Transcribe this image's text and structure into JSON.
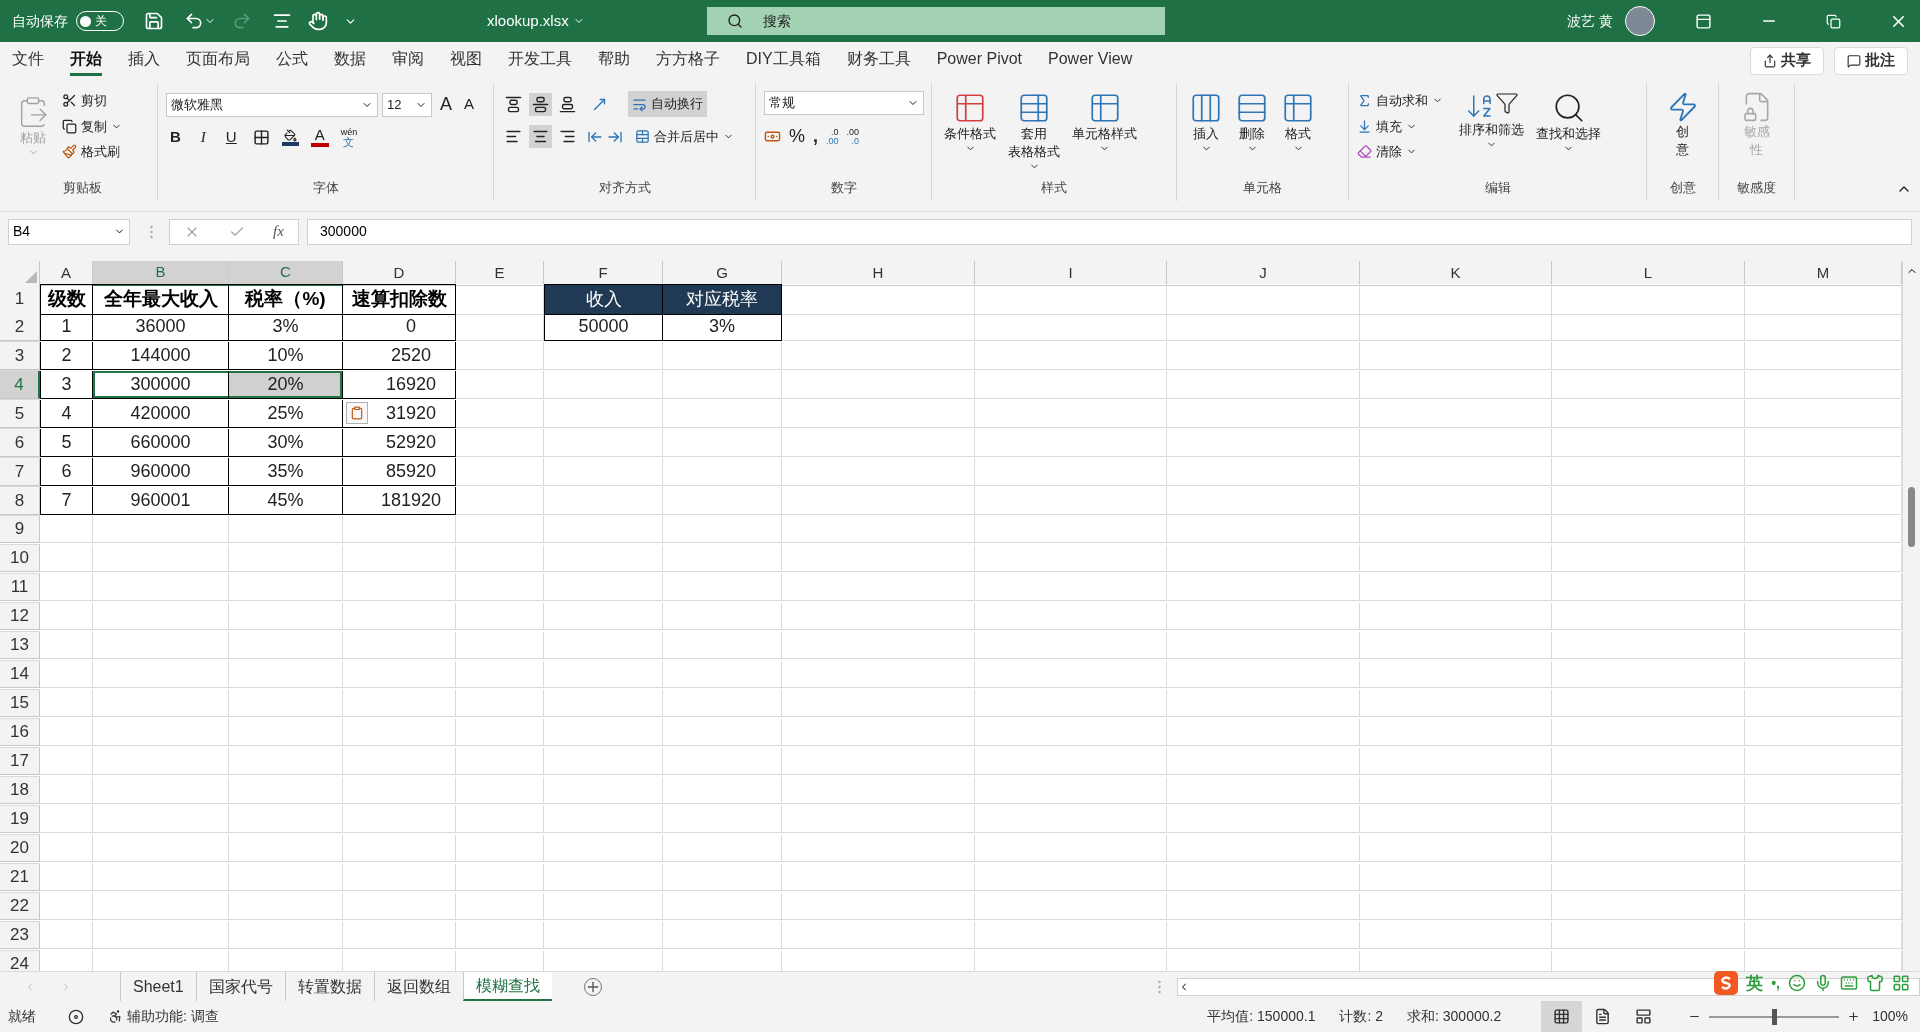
{
  "title_bar": {
    "autosave_label": "自动保存",
    "autosave_toggle": {
      "label": "关",
      "on": false
    },
    "filename": "xlookup.xlsx",
    "search_placeholder": "搜索",
    "user": "波艺 黄"
  },
  "menu_tabs": [
    {
      "label": "文件",
      "selected": false
    },
    {
      "label": "开始",
      "selected": true
    },
    {
      "label": "插入",
      "selected": false
    },
    {
      "label": "页面布局",
      "selected": false
    },
    {
      "label": "公式",
      "selected": false
    },
    {
      "label": "数据",
      "selected": false
    },
    {
      "label": "审阅",
      "selected": false
    },
    {
      "label": "视图",
      "selected": false
    },
    {
      "label": "开发工具",
      "selected": false
    },
    {
      "label": "帮助",
      "selected": false
    },
    {
      "label": "方方格子",
      "selected": false
    },
    {
      "label": "DIY工具箱",
      "selected": false
    },
    {
      "label": "财务工具",
      "selected": false
    },
    {
      "label": "Power Pivot",
      "selected": false
    },
    {
      "label": "Power View",
      "selected": false
    }
  ],
  "share_button": "共享",
  "comments_button": "批注",
  "ribbon": {
    "clipboard": {
      "label": "剪贴板",
      "paste": [
        "粘",
        "贴"
      ],
      "cut": "剪切",
      "copy": "复制",
      "format_painter": "格式刷"
    },
    "font": {
      "label": "字体",
      "font_name": "微软雅黑",
      "font_size": "12",
      "grow": "A",
      "shrink": "A",
      "bold": "B",
      "italic": "I",
      "underline": "U",
      "font_color": "A",
      "phonetic_top": "wén",
      "phonetic_bottom": "文"
    },
    "alignment": {
      "label": "对齐方式",
      "vertical": [
        {
          "selected": false
        },
        {
          "selected": true
        },
        {
          "selected": false
        }
      ],
      "horizontal": [
        {
          "selected": false
        },
        {
          "selected": true
        },
        {
          "selected": false
        }
      ],
      "wrap_text": {
        "label": "自动换行",
        "on": true
      },
      "merge": "合并后居中"
    },
    "number": {
      "label": "数字",
      "format": "常规",
      "percent": "%",
      "comma": ",",
      "increase_decimal": [
        ".0",
        ".00"
      ],
      "decrease_decimal": [
        ".00",
        ".0"
      ]
    },
    "styles": {
      "label": "样式",
      "buttons": [
        [
          "条件格式"
        ],
        [
          "套用",
          "表格格式"
        ],
        [
          "单元格样式"
        ]
      ]
    },
    "cells": {
      "label": "单元格",
      "buttons": [
        "插入",
        "删除",
        "格式"
      ]
    },
    "editing": {
      "label": "编辑",
      "small": [
        "自动求和",
        "填充",
        "清除"
      ],
      "large": [
        "排序和筛选",
        "查找和选择"
      ]
    },
    "ideas": {
      "label": "创意",
      "button": [
        "创",
        "意"
      ]
    },
    "sensitivity": {
      "label": "敏感度",
      "button": [
        "敏感",
        "性"
      ],
      "disabled": true
    }
  },
  "formula_bar": {
    "name_box": "B4",
    "fx": "fx",
    "value": "300000"
  },
  "columns": [
    {
      "label": "A",
      "selected": false
    },
    {
      "label": "B",
      "selected": true
    },
    {
      "label": "C",
      "selected": true
    },
    {
      "label": "D",
      "selected": false
    },
    {
      "label": "E",
      "selected": false
    },
    {
      "label": "F",
      "selected": false
    },
    {
      "label": "G",
      "selected": false
    },
    {
      "label": "H",
      "selected": false
    },
    {
      "label": "I",
      "selected": false
    },
    {
      "label": "J",
      "selected": false
    },
    {
      "label": "K",
      "selected": false
    },
    {
      "label": "L",
      "selected": false
    },
    {
      "label": "M",
      "selected": false
    }
  ],
  "rows": [
    {
      "label": "1",
      "selected": false
    },
    {
      "label": "2",
      "selected": false
    },
    {
      "label": "3",
      "selected": false
    },
    {
      "label": "4",
      "selected": true
    },
    {
      "label": "5",
      "selected": false
    },
    {
      "label": "6",
      "selected": false
    },
    {
      "label": "7",
      "selected": false
    },
    {
      "label": "8",
      "selected": false
    },
    {
      "label": "9",
      "selected": false
    },
    {
      "label": "10",
      "selected": false
    },
    {
      "label": "11",
      "selected": false
    },
    {
      "label": "12",
      "selected": false
    },
    {
      "label": "13",
      "selected": false
    },
    {
      "label": "14",
      "selected": false
    },
    {
      "label": "15",
      "selected": false
    },
    {
      "label": "16",
      "selected": false
    },
    {
      "label": "17",
      "selected": false
    },
    {
      "label": "18",
      "selected": false
    },
    {
      "label": "19",
      "selected": false
    },
    {
      "label": "20",
      "selected": false
    },
    {
      "label": "21",
      "selected": false
    },
    {
      "label": "22",
      "selected": false
    },
    {
      "label": "23",
      "selected": false
    },
    {
      "label": "24",
      "selected": false
    }
  ],
  "tax_table": {
    "header": [
      "级数",
      "全年最大收入",
      "税率（%)",
      "速算扣除数"
    ],
    "rows": [
      [
        {
          "text": "1",
          "selected": false,
          "active": false
        },
        {
          "text": "36000",
          "selected": false,
          "active": false
        },
        {
          "text": "3%",
          "selected": false,
          "active": false
        },
        {
          "text": "0",
          "selected": false,
          "active": false
        }
      ],
      [
        {
          "text": "2",
          "selected": false,
          "active": false
        },
        {
          "text": "144000",
          "selected": false,
          "active": false
        },
        {
          "text": "10%",
          "selected": false,
          "active": false
        },
        {
          "text": "2520",
          "selected": false,
          "active": false
        }
      ],
      [
        {
          "text": "3",
          "selected": false,
          "active": false
        },
        {
          "text": "300000",
          "selected": true,
          "active": true
        },
        {
          "text": "20%",
          "selected": true,
          "active": false
        },
        {
          "text": "16920",
          "selected": false,
          "active": false
        }
      ],
      [
        {
          "text": "4",
          "selected": false,
          "active": false
        },
        {
          "text": "420000",
          "selected": false,
          "active": false
        },
        {
          "text": "25%",
          "selected": false,
          "active": false
        },
        {
          "text": "31920",
          "selected": false,
          "active": false
        }
      ],
      [
        {
          "text": "5",
          "selected": false,
          "active": false
        },
        {
          "text": "660000",
          "selected": false,
          "active": false
        },
        {
          "text": "30%",
          "selected": false,
          "active": false
        },
        {
          "text": "52920",
          "selected": false,
          "active": false
        }
      ],
      [
        {
          "text": "6",
          "selected": false,
          "active": false
        },
        {
          "text": "960000",
          "selected": false,
          "active": false
        },
        {
          "text": "35%",
          "selected": false,
          "active": false
        },
        {
          "text": "85920",
          "selected": false,
          "active": false
        }
      ],
      [
        {
          "text": "7",
          "selected": false,
          "active": false
        },
        {
          "text": "960001",
          "selected": false,
          "active": false
        },
        {
          "text": "45%",
          "selected": false,
          "active": false
        },
        {
          "text": "181920",
          "selected": false,
          "active": false
        }
      ]
    ]
  },
  "lookup_table": {
    "header": [
      "收入",
      "对应税率"
    ],
    "rows": [
      [
        "50000",
        "3%"
      ]
    ]
  },
  "sheet_tabs": [
    {
      "label": "Sheet1",
      "selected": false
    },
    {
      "label": "国家代号",
      "selected": false
    },
    {
      "label": "转置数据",
      "selected": false
    },
    {
      "label": "返回数组",
      "selected": false
    },
    {
      "label": "模糊查找",
      "selected": true
    }
  ],
  "status_bar": {
    "ready": "就绪",
    "accessibility": "辅助功能: 调查",
    "stats": [
      "平均值: 150000.1",
      "计数: 2",
      "求和: 300000.2"
    ],
    "views": [
      {
        "selected": true
      },
      {
        "selected": false
      },
      {
        "selected": false
      }
    ],
    "level": 0.5,
    "zoom": "100%"
  },
  "ime_bar": {
    "language": "英",
    "punctuation": "•,"
  }
}
